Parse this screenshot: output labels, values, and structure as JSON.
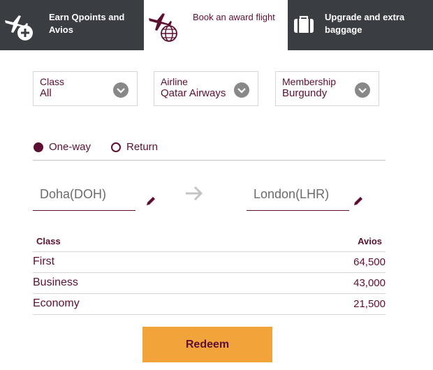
{
  "tabs": [
    {
      "label": "Earn Qpoints and Avios",
      "icon": "plane-plus-icon",
      "active": false
    },
    {
      "label": "Book an award flight",
      "icon": "plane-globe-icon",
      "active": true
    },
    {
      "label": "Upgrade and extra baggage",
      "icon": "suitcase-icon",
      "active": false
    }
  ],
  "filters": {
    "class": {
      "label": "Class",
      "value": "All"
    },
    "airline": {
      "label": "Airline",
      "value": "Qatar Airways"
    },
    "membership": {
      "label": "Membership",
      "value": "Burgundy"
    }
  },
  "trip_type": {
    "options": [
      "One-way",
      "Return"
    ],
    "selected": "One-way"
  },
  "route": {
    "origin": "Doha(DOH)",
    "destination": "London(LHR)"
  },
  "table": {
    "headers": [
      "Class",
      "Avios"
    ],
    "rows": [
      {
        "class": "First",
        "avios": "64,500"
      },
      {
        "class": "Business",
        "avios": "43,000"
      },
      {
        "class": "Economy",
        "avios": "21,500"
      }
    ]
  },
  "redeem_label": "Redeem",
  "colors": {
    "brand": "#5c0f30",
    "tab_dark": "#3a3d42",
    "button": "#f2a33a",
    "chevron_bg": "#888888"
  }
}
